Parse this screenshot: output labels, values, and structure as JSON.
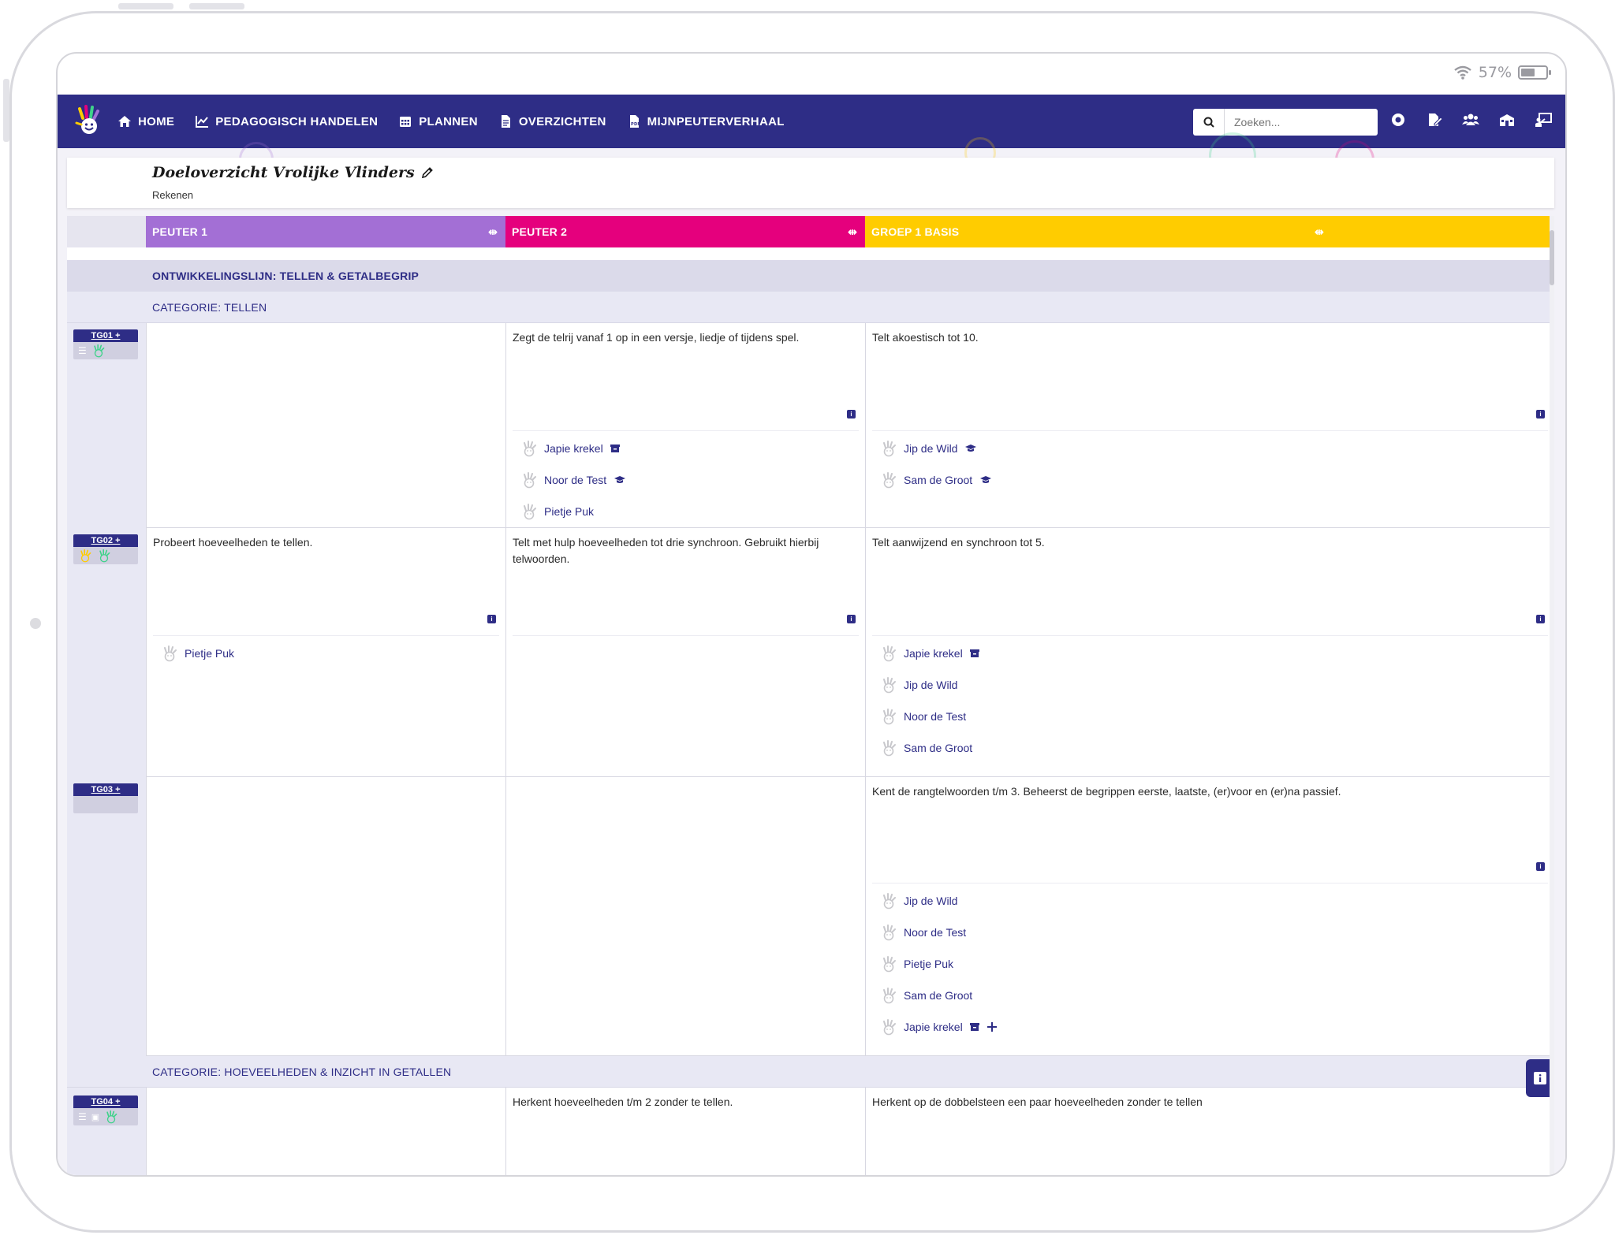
{
  "status": {
    "battery": "57%"
  },
  "nav": {
    "items": [
      {
        "label": "HOME"
      },
      {
        "label": "PEDAGOGISCH HANDELEN"
      },
      {
        "label": "PLANNEN"
      },
      {
        "label": "OVERZICHTEN"
      },
      {
        "label": "MIJNPEUTERVERHAAL"
      }
    ],
    "search_placeholder": "Zoeken..."
  },
  "page": {
    "title": "Doeloverzicht Vrolijke Vlinders",
    "subtitle": "Rekenen"
  },
  "columns": [
    {
      "label": "PEUTER 1",
      "color": "#a36fd5"
    },
    {
      "label": "PEUTER 2",
      "color": "#e5007d"
    },
    {
      "label": "GROEP 1 BASIS",
      "color": "#ffcc00"
    }
  ],
  "line": "ONTWIKKELINGSLIJN: TELLEN & GETALBEGRIP",
  "categories": [
    "CATEGORIE: TELLEN",
    "CATEGORIE: HOEVEELHEDEN & INZICHT IN GETALLEN"
  ],
  "rows": [
    {
      "code": "TG01 +",
      "cells": [
        {
          "desc": "",
          "kids": []
        },
        {
          "desc": "Zegt de telrij vanaf 1 op in een versje, liedje of tijdens spel.",
          "kids": [
            "Japie krekel",
            "Noor de Test",
            "Pietje Puk"
          ]
        },
        {
          "desc": "Telt akoestisch tot 10.",
          "kids": [
            "Jip de Wild",
            "Sam de Groot"
          ]
        }
      ]
    },
    {
      "code": "TG02 +",
      "cells": [
        {
          "desc": "Probeert hoeveelheden te tellen.",
          "kids": [
            "Pietje Puk"
          ]
        },
        {
          "desc": "Telt met hulp hoeveelheden tot drie synchroon. Gebruikt hierbij telwoorden.",
          "kids": []
        },
        {
          "desc": "Telt aanwijzend en synchroon tot 5.",
          "kids": [
            "Japie krekel",
            "Jip de Wild",
            "Noor de Test",
            "Sam de Groot"
          ]
        }
      ]
    },
    {
      "code": "TG03 +",
      "cells": [
        {
          "desc": "",
          "kids": []
        },
        {
          "desc": "",
          "kids": []
        },
        {
          "desc": "Kent de rangtelwoorden t/m 3. Beheerst de begrippen eerste, laatste, (er)voor en (er)na passief.",
          "kids": [
            "Jip de Wild",
            "Noor de Test",
            "Pietje Puk",
            "Sam de Groot",
            "Japie krekel"
          ]
        }
      ]
    },
    {
      "code": "TG04 +",
      "cells": [
        {
          "desc": "",
          "kids": []
        },
        {
          "desc": "Herkent hoeveelheden t/m 2 zonder te tellen.",
          "kids": []
        },
        {
          "desc": "Herkent op de dobbelsteen een paar hoeveelheden zonder te tellen",
          "kids": []
        }
      ]
    }
  ],
  "icons": {
    "kid_marker": "hand-face-icon",
    "archive": "archive-box-icon",
    "graduate": "graduation-cap-icon",
    "add": "plus-icon",
    "info": "info-icon",
    "expand": "expand-horizontal-icon"
  },
  "colors": {
    "primary": "#2e2d86",
    "background": "#f3f2f8"
  }
}
